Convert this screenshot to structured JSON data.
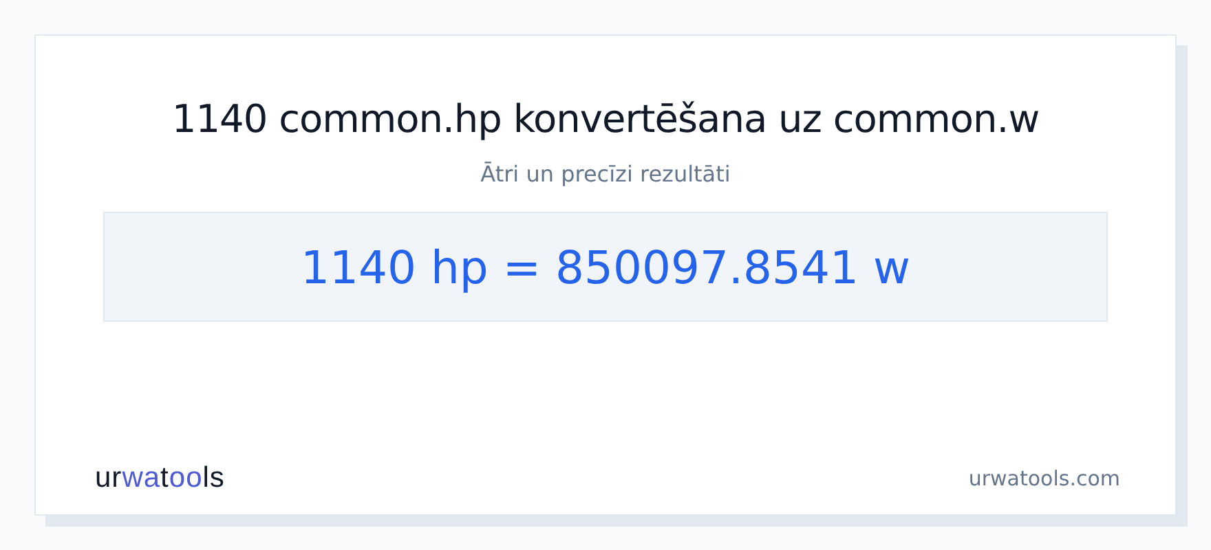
{
  "title": "1140 common.hp konvertēšana uz common.w",
  "subtitle": "Ātri un precīzi rezultāti",
  "result": "1140 hp = 850097.8541 w",
  "logo": {
    "parts": [
      {
        "text": "ur",
        "color": "#111827"
      },
      {
        "text": "wa",
        "color": "#4f5bd5"
      },
      {
        "text": "t",
        "color": "#111827"
      },
      {
        "text": "oo",
        "color": "#4f5bd5"
      },
      {
        "text": "ls",
        "color": "#111827"
      }
    ]
  },
  "site": "urwatools.com"
}
